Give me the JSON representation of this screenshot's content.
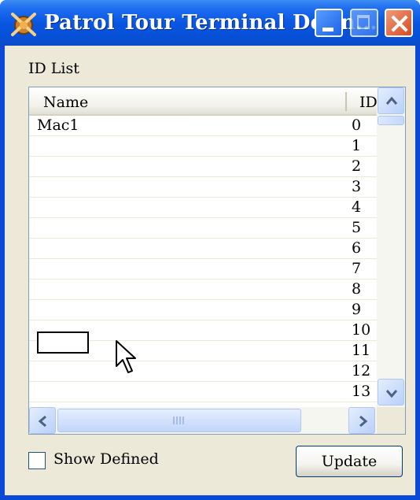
{
  "window": {
    "title": "Patrol Tour Terminal Defin...",
    "accent": "#0a48d8",
    "controls": {
      "minimize": "minimize-icon",
      "maximize": "maximize-icon",
      "close": "close-icon"
    }
  },
  "id_list": {
    "label": "ID List",
    "columns": {
      "name": "Name",
      "id": "ID"
    },
    "rows": [
      {
        "name": "Mac1",
        "id": "0"
      },
      {
        "name": "",
        "id": "1"
      },
      {
        "name": "",
        "id": "2"
      },
      {
        "name": "",
        "id": "3"
      },
      {
        "name": "",
        "id": "4"
      },
      {
        "name": "",
        "id": "5"
      },
      {
        "name": "",
        "id": "6"
      },
      {
        "name": "",
        "id": "7"
      },
      {
        "name": "",
        "id": "8"
      },
      {
        "name": "",
        "id": "9"
      },
      {
        "name": "",
        "id": "10"
      },
      {
        "name": "",
        "id": "11"
      },
      {
        "name": "",
        "id": "12"
      },
      {
        "name": "",
        "id": "13"
      }
    ]
  },
  "footer": {
    "show_defined_label": "Show Defined",
    "show_defined_checked": false,
    "update_label": "Update"
  }
}
